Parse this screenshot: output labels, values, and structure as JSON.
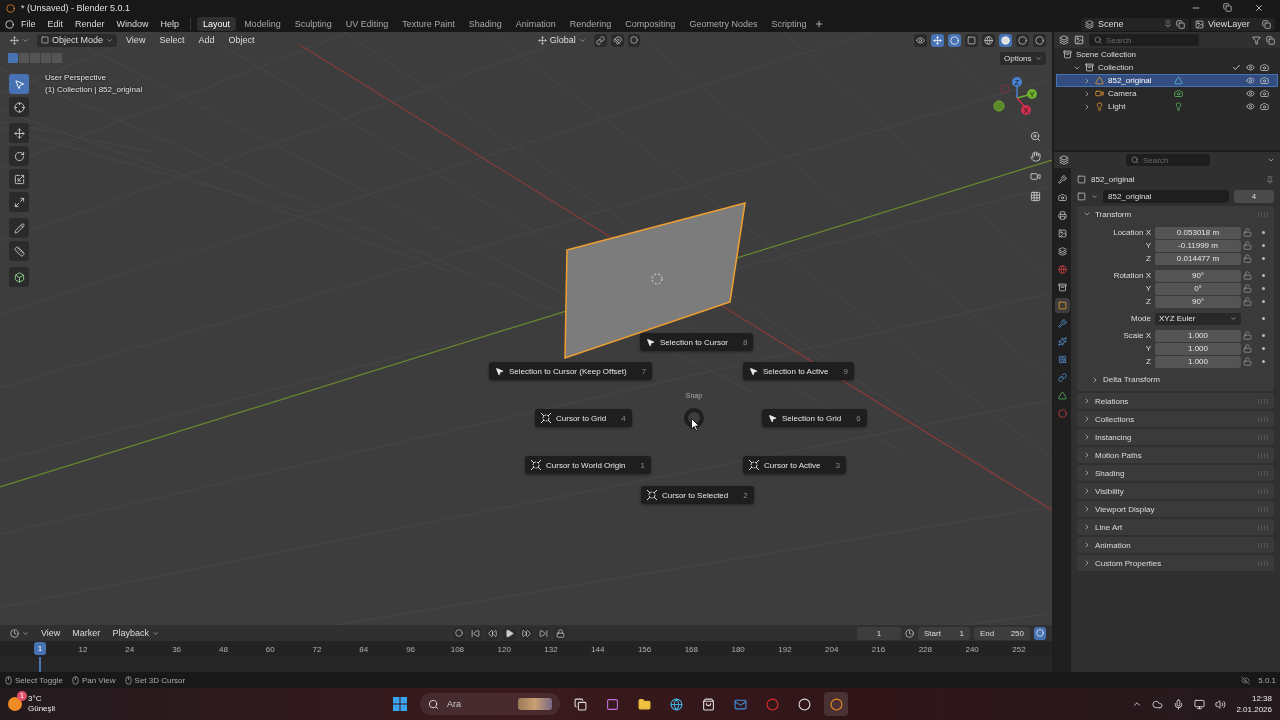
{
  "window": {
    "title": "* (Unsaved) - Blender 5.0.1"
  },
  "menu": [
    "File",
    "Edit",
    "Render",
    "Window",
    "Help"
  ],
  "workspaces": [
    {
      "label": "Layout",
      "selected": true
    },
    {
      "label": "Modeling",
      "selected": false
    },
    {
      "label": "Sculpting",
      "selected": false
    },
    {
      "label": "UV Editing",
      "selected": false
    },
    {
      "label": "Texture Paint",
      "selected": false
    },
    {
      "label": "Shading",
      "selected": false
    },
    {
      "label": "Animation",
      "selected": false
    },
    {
      "label": "Rendering",
      "selected": false
    },
    {
      "label": "Compositing",
      "selected": false
    },
    {
      "label": "Geometry Nodes",
      "selected": false
    },
    {
      "label": "Scripting",
      "selected": false
    }
  ],
  "scene": "Scene",
  "view_layer": "ViewLayer",
  "viewport": {
    "mode": "Object Mode",
    "menus": [
      "View",
      "Select",
      "Add",
      "Object"
    ],
    "orientation": "Global",
    "options": "Options",
    "overlay_text": [
      "User Perspective",
      "(1) Collection | 852_original"
    ],
    "gizmo_axes": [
      "X",
      "Y",
      "Z"
    ],
    "pie": {
      "title": "Snap",
      "items": [
        {
          "label": "Selection to Cursor",
          "key": "8",
          "kind": "selection"
        },
        {
          "label": "Selection to Cursor (Keep Offset)",
          "key": "7",
          "kind": "selection"
        },
        {
          "label": "Selection to Active",
          "key": "9",
          "kind": "selection"
        },
        {
          "label": "Cursor to Grid",
          "key": "4",
          "kind": "cursor"
        },
        {
          "label": "Selection to Grid",
          "key": "6",
          "kind": "selection"
        },
        {
          "label": "Cursor to World Origin",
          "key": "1",
          "kind": "cursor"
        },
        {
          "label": "Cursor to Active",
          "key": "3",
          "kind": "cursor"
        },
        {
          "label": "Cursor to Selected",
          "key": "2",
          "kind": "cursor"
        }
      ]
    }
  },
  "outliner": {
    "search_placeholder": "Search",
    "items": [
      {
        "label": "Scene Collection",
        "kind": "scene",
        "children": [
          {
            "label": "Collection",
            "kind": "collection",
            "expanded": true,
            "selected": false,
            "children": [
              {
                "label": "852_original",
                "kind": "mesh",
                "selected": true,
                "expanded": false
              },
              {
                "label": "Camera",
                "kind": "camera",
                "selected": false,
                "expanded": false
              },
              {
                "label": "Light",
                "kind": "light",
                "selected": false,
                "expanded": false
              }
            ]
          }
        ]
      }
    ]
  },
  "properties": {
    "search_placeholder": "Search",
    "tabs": [
      {
        "kind": "tool",
        "selected": false
      },
      {
        "kind": "render",
        "selected": false
      },
      {
        "kind": "output",
        "selected": false
      },
      {
        "kind": "view",
        "selected": false
      },
      {
        "kind": "scene",
        "selected": false
      },
      {
        "kind": "world",
        "selected": false
      },
      {
        "kind": "collection",
        "selected": false
      },
      {
        "kind": "object",
        "selected": true
      },
      {
        "kind": "modifier",
        "selected": false
      },
      {
        "kind": "particles",
        "selected": false
      },
      {
        "kind": "physics",
        "selected": false
      },
      {
        "kind": "constraint",
        "selected": false
      },
      {
        "kind": "data",
        "selected": false
      },
      {
        "kind": "material",
        "selected": false
      }
    ],
    "object_name": "852_original",
    "data_name": "852_original",
    "users": "4",
    "transform": {
      "label": "Transform",
      "expanded": true,
      "rows": [
        {
          "label": "Location X",
          "value": "0.053018 m",
          "kind": "number",
          "group_start": true
        },
        {
          "label": "Y",
          "value": "-0.11999 m",
          "kind": "number",
          "group_start": false
        },
        {
          "label": "Z",
          "value": "0.014477 m",
          "kind": "number",
          "group_start": false
        },
        {
          "label": "Rotation X",
          "value": "90°",
          "kind": "number",
          "group_start": true
        },
        {
          "label": "Y",
          "value": "0°",
          "kind": "number",
          "group_start": false
        },
        {
          "label": "Z",
          "value": "90°",
          "kind": "number",
          "group_start": false
        },
        {
          "label": "Mode",
          "value": "XYZ Euler",
          "kind": "dropdown",
          "group_start": true
        },
        {
          "label": "Scale X",
          "value": "1.000",
          "kind": "number",
          "group_start": true
        },
        {
          "label": "Y",
          "value": "1.000",
          "kind": "number",
          "group_start": false
        },
        {
          "label": "Z",
          "value": "1.000",
          "kind": "number",
          "group_start": false
        }
      ],
      "subpanel": {
        "label": "Delta Transform",
        "expanded": false
      }
    },
    "panels": [
      {
        "label": "Relations",
        "expanded": false
      },
      {
        "label": "Collections",
        "expanded": false
      },
      {
        "label": "Instancing",
        "expanded": false
      },
      {
        "label": "Motion Paths",
        "expanded": false
      },
      {
        "label": "Shading",
        "expanded": false
      },
      {
        "label": "Visibility",
        "expanded": false
      },
      {
        "label": "Viewport Display",
        "expanded": false
      },
      {
        "label": "Line Art",
        "expanded": false
      },
      {
        "label": "Animation",
        "expanded": false
      },
      {
        "label": "Custom Properties",
        "expanded": false
      }
    ]
  },
  "timeline": {
    "menus": [
      "View",
      "Marker",
      "Playback"
    ],
    "current_frame": "1",
    "start_label": "Start",
    "start": "1",
    "end_label": "End",
    "end": "250",
    "playhead": "1",
    "ticks": [
      "12",
      "24",
      "36",
      "48",
      "60",
      "72",
      "84",
      "96",
      "108",
      "120",
      "132",
      "144",
      "156",
      "168",
      "180",
      "192",
      "204",
      "216",
      "228",
      "240",
      "252"
    ]
  },
  "status_bar": {
    "hints": [
      "Select Toggle",
      "Pan View",
      "Set 3D Cursor"
    ],
    "version": "5.0.1"
  },
  "taskbar": {
    "temperature": "3°C",
    "condition": "Güneşli",
    "weather_badge": "1",
    "search_placeholder": "Ara",
    "time": "12:38",
    "date": "2.01.2026"
  }
}
